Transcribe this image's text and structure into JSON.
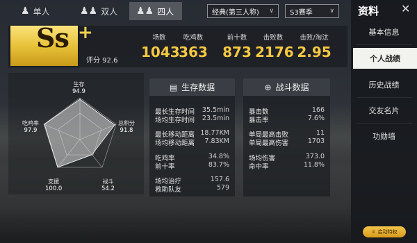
{
  "modes": [
    {
      "label": "单人",
      "icon": "single-person-icon",
      "glyph": "♟"
    },
    {
      "label": "双人",
      "icon": "duo-icon",
      "glyph": "♟♟"
    },
    {
      "label": "四人",
      "icon": "squad-icon",
      "glyph": "♟♟"
    }
  ],
  "perspective": {
    "selected": "经典(第三人称)"
  },
  "season": {
    "selected": "S3赛季"
  },
  "sidebar": {
    "title": "资料",
    "items": [
      {
        "label": "基本信息"
      },
      {
        "label": "个人战绩"
      },
      {
        "label": "历史战绩"
      },
      {
        "label": "交友名片"
      },
      {
        "label": "功勋墙"
      }
    ],
    "vip_label": "启动特权"
  },
  "rank": {
    "tier": "Ss",
    "plus": "+",
    "rating": "评分 92.6"
  },
  "summary": [
    {
      "label": "场数",
      "value": "1043"
    },
    {
      "label": "吃鸡数",
      "value": "363"
    },
    {
      "label": "前十数",
      "value": "873"
    },
    {
      "label": "击败数",
      "value": "2176"
    },
    {
      "label": "击败/淘汰",
      "value": "2.95"
    }
  ],
  "radar": {
    "axes": [
      {
        "label": "生存",
        "value": "94.9"
      },
      {
        "label": "总积分",
        "value": "91.8"
      },
      {
        "label": "战斗",
        "value": "54.2"
      },
      {
        "label": "支援",
        "value": "100.0"
      },
      {
        "label": "吃鸡率",
        "value": "97.9"
      }
    ]
  },
  "survival": {
    "title": "生存数据",
    "rows": [
      {
        "label": "最长生存时间",
        "value": "35.5min"
      },
      {
        "label": "场均生存时间",
        "value": "23.5min"
      },
      {
        "label": "最长移动距离",
        "value": "18.77KM"
      },
      {
        "label": "场均移动距离",
        "value": "7.83KM"
      },
      {
        "label": "吃鸡率",
        "value": "34.8%"
      },
      {
        "label": "前十率",
        "value": "83.7%"
      },
      {
        "label": "场均治疗",
        "value": "157.6"
      },
      {
        "label": "救助队友",
        "value": "579"
      }
    ]
  },
  "combat": {
    "title": "战斗数据",
    "rows": [
      {
        "label": "暴击数",
        "value": "166"
      },
      {
        "label": "暴击率",
        "value": "7.6%"
      },
      {
        "label": "单局最高击败",
        "value": "11"
      },
      {
        "label": "单局最高伤害",
        "value": "1703"
      },
      {
        "label": "场均伤害",
        "value": "373.0"
      },
      {
        "label": "命中率",
        "value": "11.8%"
      }
    ]
  }
}
